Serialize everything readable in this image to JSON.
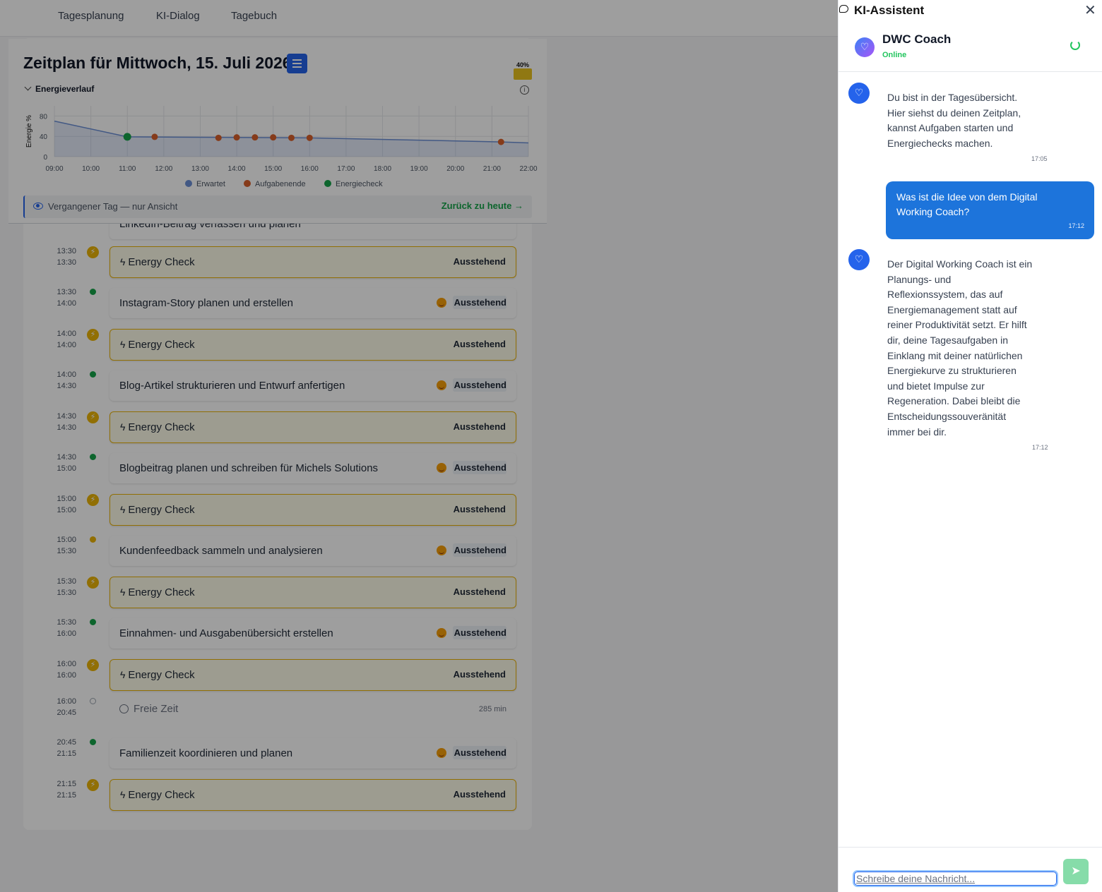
{
  "nav": {
    "items": [
      "Tagesplanung",
      "KI-Dialog",
      "Tagebuch"
    ]
  },
  "schedule": {
    "title": "Zeitplan für Mittwoch, 15. Juli 2026",
    "battery_label": "40%",
    "battery_color": "#e9c21d",
    "energy_toggle": "Energieverlauf",
    "past_banner": "Vergangener Tag — nur Ansicht",
    "back_link": "Zurück zu heute",
    "partial_row": "LinkedIn-Beitrag verfassen und planen"
  },
  "chart_data": {
    "type": "line",
    "ylabel": "Energie %",
    "ylim": [
      0,
      100
    ],
    "yticks": [
      0,
      40,
      80
    ],
    "xticks": [
      "09:00",
      "10:00",
      "11:00",
      "12:00",
      "13:00",
      "14:00",
      "15:00",
      "16:00",
      "17:00",
      "18:00",
      "19:00",
      "20:00",
      "21:00",
      "22:00"
    ],
    "xlim_hours": [
      9,
      22
    ],
    "grid": true,
    "legend_position": "bottom",
    "legend": [
      {
        "name": "Erwartet",
        "color": "#6b8fd6"
      },
      {
        "name": "Aufgabenende",
        "color": "#d8602a"
      },
      {
        "name": "Energiecheck",
        "color": "#16a34a"
      }
    ],
    "series": [
      {
        "name": "Erwartet",
        "points": [
          [
            9.0,
            70
          ],
          [
            11.0,
            39
          ],
          [
            13.5,
            38
          ],
          [
            16.0,
            37
          ],
          [
            21.25,
            29
          ],
          [
            22.0,
            27
          ]
        ]
      },
      {
        "name": "Aufgabenende",
        "points": [
          [
            11.75,
            39
          ],
          [
            13.5,
            37
          ],
          [
            14.0,
            38
          ],
          [
            14.5,
            38
          ],
          [
            15.0,
            38
          ],
          [
            15.5,
            37
          ],
          [
            16.0,
            37
          ],
          [
            21.25,
            29
          ]
        ]
      },
      {
        "name": "Energiecheck",
        "points": [
          [
            11.0,
            39
          ]
        ]
      }
    ]
  },
  "timeline": {
    "status_pending": "Ausstehend",
    "rows": [
      {
        "kind": "ec",
        "start": "13:30",
        "end": "13:30",
        "title": "Energy Check"
      },
      {
        "kind": "task",
        "start": "13:30",
        "end": "14:00",
        "title": "Instagram-Story planen und erstellen",
        "dot": "green"
      },
      {
        "kind": "ec",
        "start": "14:00",
        "end": "14:00",
        "title": "Energy Check"
      },
      {
        "kind": "task",
        "start": "14:00",
        "end": "14:30",
        "title": "Blog-Artikel strukturieren und Entwurf anfertigen",
        "dot": "green"
      },
      {
        "kind": "ec",
        "start": "14:30",
        "end": "14:30",
        "title": "Energy Check"
      },
      {
        "kind": "task",
        "start": "14:30",
        "end": "15:00",
        "title": "Blogbeitrag planen und schreiben für Michels Solutions",
        "dot": "green"
      },
      {
        "kind": "ec",
        "start": "15:00",
        "end": "15:00",
        "title": "Energy Check"
      },
      {
        "kind": "task",
        "start": "15:00",
        "end": "15:30",
        "title": "Kundenfeedback sammeln und analysieren",
        "dot": "yellow"
      },
      {
        "kind": "ec",
        "start": "15:30",
        "end": "15:30",
        "title": "Energy Check"
      },
      {
        "kind": "task",
        "start": "15:30",
        "end": "16:00",
        "title": "Einnahmen- und Ausgabenübersicht erstellen",
        "dot": "green"
      },
      {
        "kind": "ec",
        "start": "16:00",
        "end": "16:00",
        "title": "Energy Check"
      },
      {
        "kind": "free",
        "start": "16:00",
        "end": "20:45",
        "title": "Freie Zeit",
        "duration": "285 min"
      },
      {
        "kind": "task",
        "start": "20:45",
        "end": "21:15",
        "title": "Familienzeit koordinieren und planen",
        "dot": "green"
      },
      {
        "kind": "ec",
        "start": "21:15",
        "end": "21:15",
        "title": "Energy Check"
      }
    ]
  },
  "assistant": {
    "title": "KI-Assistent",
    "coach_name": "DWC Coach",
    "coach_status": "Online",
    "messages": [
      {
        "from": "coach",
        "text": "Du bist in der Tagesübersicht.\nHier siehst du deinen Zeitplan,\nkannst Aufgaben starten und\nEnergiechecks machen.",
        "time": "17:05"
      },
      {
        "from": "user",
        "text": "Was ist die Idee von dem Digital\nWorking Coach?",
        "time": "17:12"
      },
      {
        "from": "coach",
        "text": "Der Digital Working Coach ist ein\nPlanungs- und\nReflexionssystem, das auf\nEnergiemanagement statt auf\nreiner Produktivität setzt. Er hilft\ndir, deine Tagesaufgaben in\nEinklang mit deiner natürlichen\nEnergiekurve zu strukturieren\nund bietet Impulse zur\nRegeneration. Dabei bleibt die\nEntscheidungssouveränität\nimmer bei dir.",
        "time": "17:12"
      }
    ],
    "input_placeholder": "Schreibe deine Nachricht...",
    "accent": "#1d74db",
    "send_color": "#86dca9"
  }
}
